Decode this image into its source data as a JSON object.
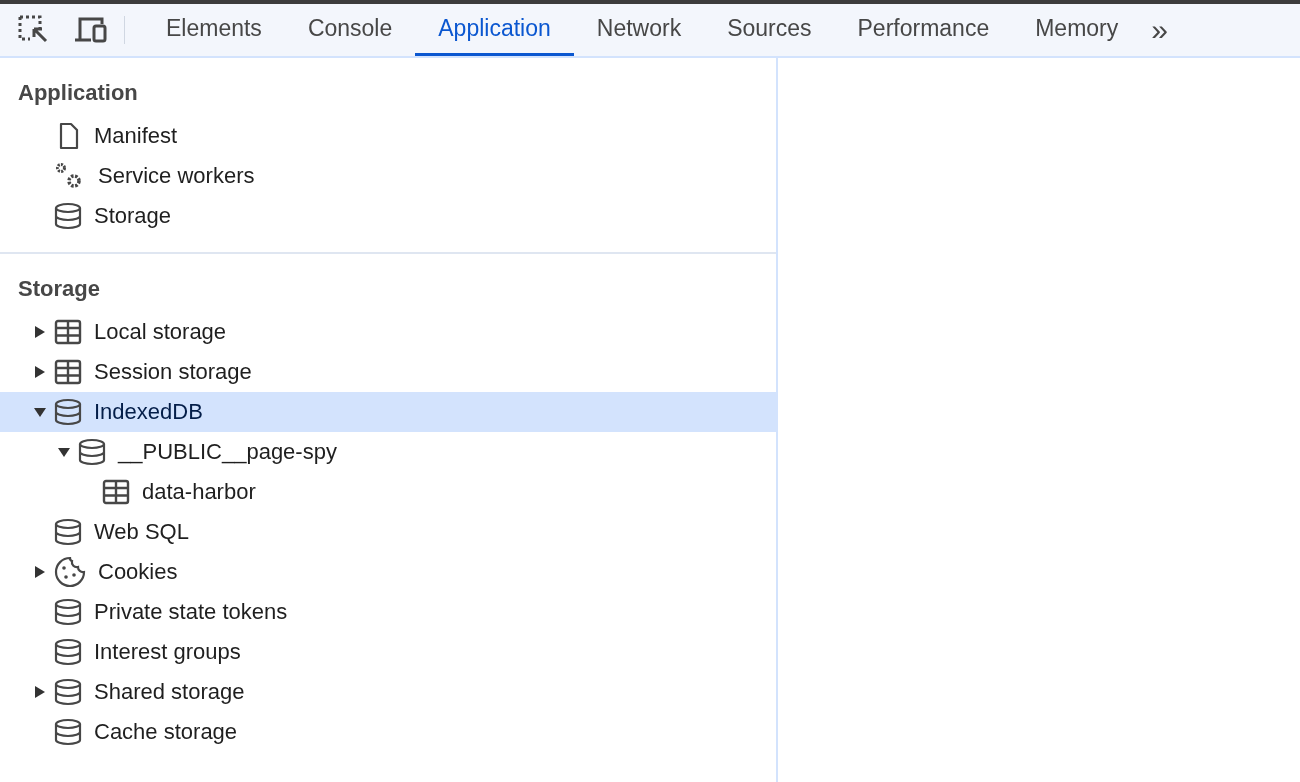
{
  "toolbar": {
    "tabs": [
      {
        "label": "Elements",
        "selected": false
      },
      {
        "label": "Console",
        "selected": false
      },
      {
        "label": "Application",
        "selected": true
      },
      {
        "label": "Network",
        "selected": false
      },
      {
        "label": "Sources",
        "selected": false
      },
      {
        "label": "Performance",
        "selected": false
      },
      {
        "label": "Memory",
        "selected": false
      }
    ],
    "overflow": "»"
  },
  "sidebar": {
    "sections": [
      {
        "title": "Application",
        "items": [
          {
            "label": "Manifest",
            "kind": "file",
            "selected": false
          },
          {
            "label": "Service workers",
            "kind": "gears",
            "selected": false
          },
          {
            "label": "Storage",
            "kind": "database",
            "selected": false
          }
        ]
      },
      {
        "title": "Storage",
        "items": [
          {
            "label": "Local storage",
            "kind": "table",
            "expanded": false,
            "selected": false
          },
          {
            "label": "Session storage",
            "kind": "table",
            "expanded": false,
            "selected": false
          },
          {
            "label": "IndexedDB",
            "kind": "database",
            "expanded": true,
            "selected": true,
            "children": [
              {
                "label": "__PUBLIC__page-spy",
                "kind": "database",
                "expanded": true,
                "selected": false,
                "children": [
                  {
                    "label": "data-harbor",
                    "kind": "table",
                    "selected": false
                  }
                ]
              }
            ]
          },
          {
            "label": "Web SQL",
            "kind": "database",
            "selected": false
          },
          {
            "label": "Cookies",
            "kind": "cookie",
            "expanded": false,
            "selected": false
          },
          {
            "label": "Private state tokens",
            "kind": "database",
            "selected": false
          },
          {
            "label": "Interest groups",
            "kind": "database",
            "selected": false
          },
          {
            "label": "Shared storage",
            "kind": "database",
            "expanded": false,
            "selected": false
          },
          {
            "label": "Cache storage",
            "kind": "database",
            "selected": false
          }
        ]
      }
    ]
  }
}
